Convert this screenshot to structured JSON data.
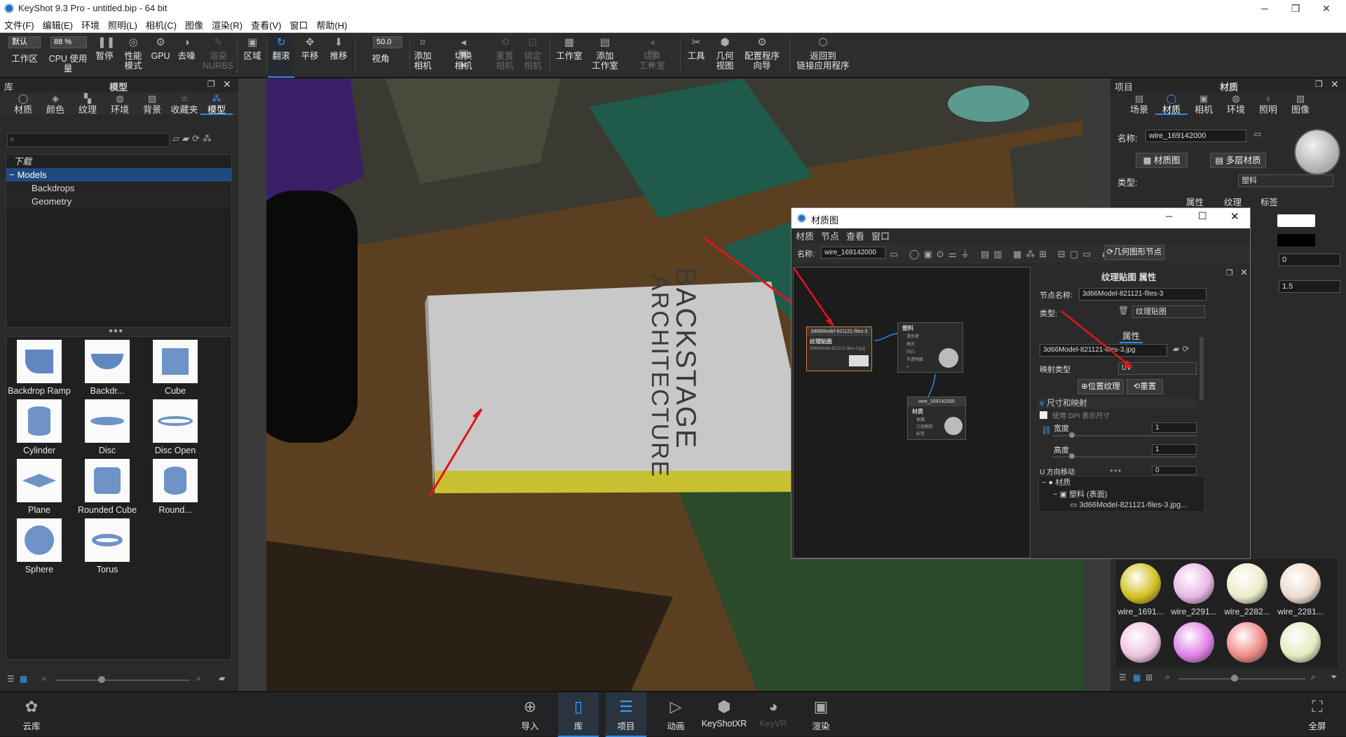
{
  "titlebar": {
    "title": "KeyShot 9.3 Pro  - untitled.bip  - 64 bit",
    "min": "─",
    "max": "❐",
    "close": "✕"
  },
  "menu": [
    "文件(F)",
    "编辑(E)",
    "环境",
    "照明(L)",
    "相机(C)",
    "图像",
    "渲染(R)",
    "查看(V)",
    "窗口",
    "帮助(H)"
  ],
  "toolbar": {
    "preset": "默认",
    "zoom": "88 %",
    "fov": "50.0",
    "items": {
      "workspace": "工作区",
      "cpu": "CPU 使用量",
      "pause": "暂停",
      "perf": "性能\n模式",
      "gpu": "GPU",
      "denoise": "去噪",
      "render_nurbs": "渲染\nNURBS",
      "region": "区域",
      "tumble": "翻滚",
      "pan": "平移",
      "dolly": "推移",
      "view": "视角",
      "add_camera": "添加\n相机",
      "switch_camera": "切换\n相机",
      "reset_camera": "重置\n相机",
      "lock_camera": "锁定\n相机",
      "studio": "工作室",
      "add_studio": "添加\n工作室",
      "switch_studio": "切换\n工作室",
      "tools": "工具",
      "geom_view": "几何\n视图",
      "config_wizard": "配置程序\n向导",
      "back_link": "返回到\n链接应用程序"
    }
  },
  "left": {
    "title": "库",
    "subtitle": "模型",
    "tabs": [
      "材质",
      "颜色",
      "纹理",
      "环境",
      "背景",
      "收藏夹",
      "模型"
    ],
    "active_tab": "模型",
    "tree": [
      "下载",
      "Models",
      "Backdrops",
      "Geometry"
    ],
    "models": [
      "Backdrop Ramp",
      "Backdr...",
      "Cube",
      "Cylinder",
      "Disc",
      "Disc Open",
      "Plane",
      "Rounded Cube",
      "Round...",
      "Sphere",
      "Torus"
    ]
  },
  "right": {
    "title": "项目",
    "subtitle": "材质",
    "tabs": [
      "场景",
      "材质",
      "相机",
      "环境",
      "照明",
      "图像"
    ],
    "active_tab": "材质",
    "name_label": "名称:",
    "name_value": "wire_169142000",
    "btn_graph": "材质图",
    "btn_multi": "多层材质",
    "type_label": "类型:",
    "type_value": "塑料",
    "subtabs": [
      "属性",
      "纹理",
      "标签"
    ],
    "val1": "0",
    "val2": "1.5",
    "swatches": [
      "wire_1691...",
      "wire_2291...",
      "wire_2282...",
      "wire_2281...",
      "",
      "",
      "",
      ""
    ],
    "swatch_colors": [
      "#d2c020",
      "#e7b6e4",
      "#ecebc8",
      "#eedbcc",
      "#efc3de",
      "#e07fe6",
      "#ee8a86",
      "#e3ecc0"
    ]
  },
  "mg": {
    "title": "材质图",
    "menu": [
      "材质",
      "节点",
      "查看",
      "窗口"
    ],
    "name_label": "名称:",
    "name_value": "wire_169142000",
    "geom_btn": "几何图形节点",
    "panel_title": "纹理贴图 属性",
    "node_name_label": "节点名称:",
    "node_name_value": "3d66Model-821121-files-3",
    "type_label": "类型:",
    "type_value": "纹理贴图",
    "attr_tab": "属性",
    "file_value": "3d66Model-821121-files-3.jpg",
    "map_label": "映射类型",
    "map_value": "UV",
    "btn_pos": "位置纹理",
    "btn_reset": "重置",
    "section": "尺寸和映射",
    "dpi": "使用 DPI 表示尺寸",
    "width_label": "宽度",
    "width_value": "1",
    "height_label": "高度",
    "height_value": "1",
    "u_label": "U 方向移动",
    "u_value": "0",
    "tree": [
      "材质",
      "塑料 (表面)",
      "3d66Model-821121-files-3.jpg..."
    ],
    "node1_header": "3d66Model-821121-files-3",
    "node1_title": "纹理贴图",
    "node1_file": "3d66Model-821121-files-3.jpg",
    "node2_title": "塑料",
    "node2_ports": [
      "漫反射",
      "高光",
      "凹凸",
      "不透明度",
      "+"
    ],
    "node3_header": "wire_169142000",
    "node3_title": "材质",
    "node3_ports": [
      "表面",
      "几何图形",
      "标签"
    ]
  },
  "book": {
    "line1": "BACKSTAGE",
    "line2": "ARCHITECTURE"
  },
  "bottom": [
    "云库",
    "导入",
    "库",
    "项目",
    "动画",
    "KeyShotXR",
    "KeyVR",
    "渲染",
    "全屏"
  ],
  "accent": "#2d8bea"
}
